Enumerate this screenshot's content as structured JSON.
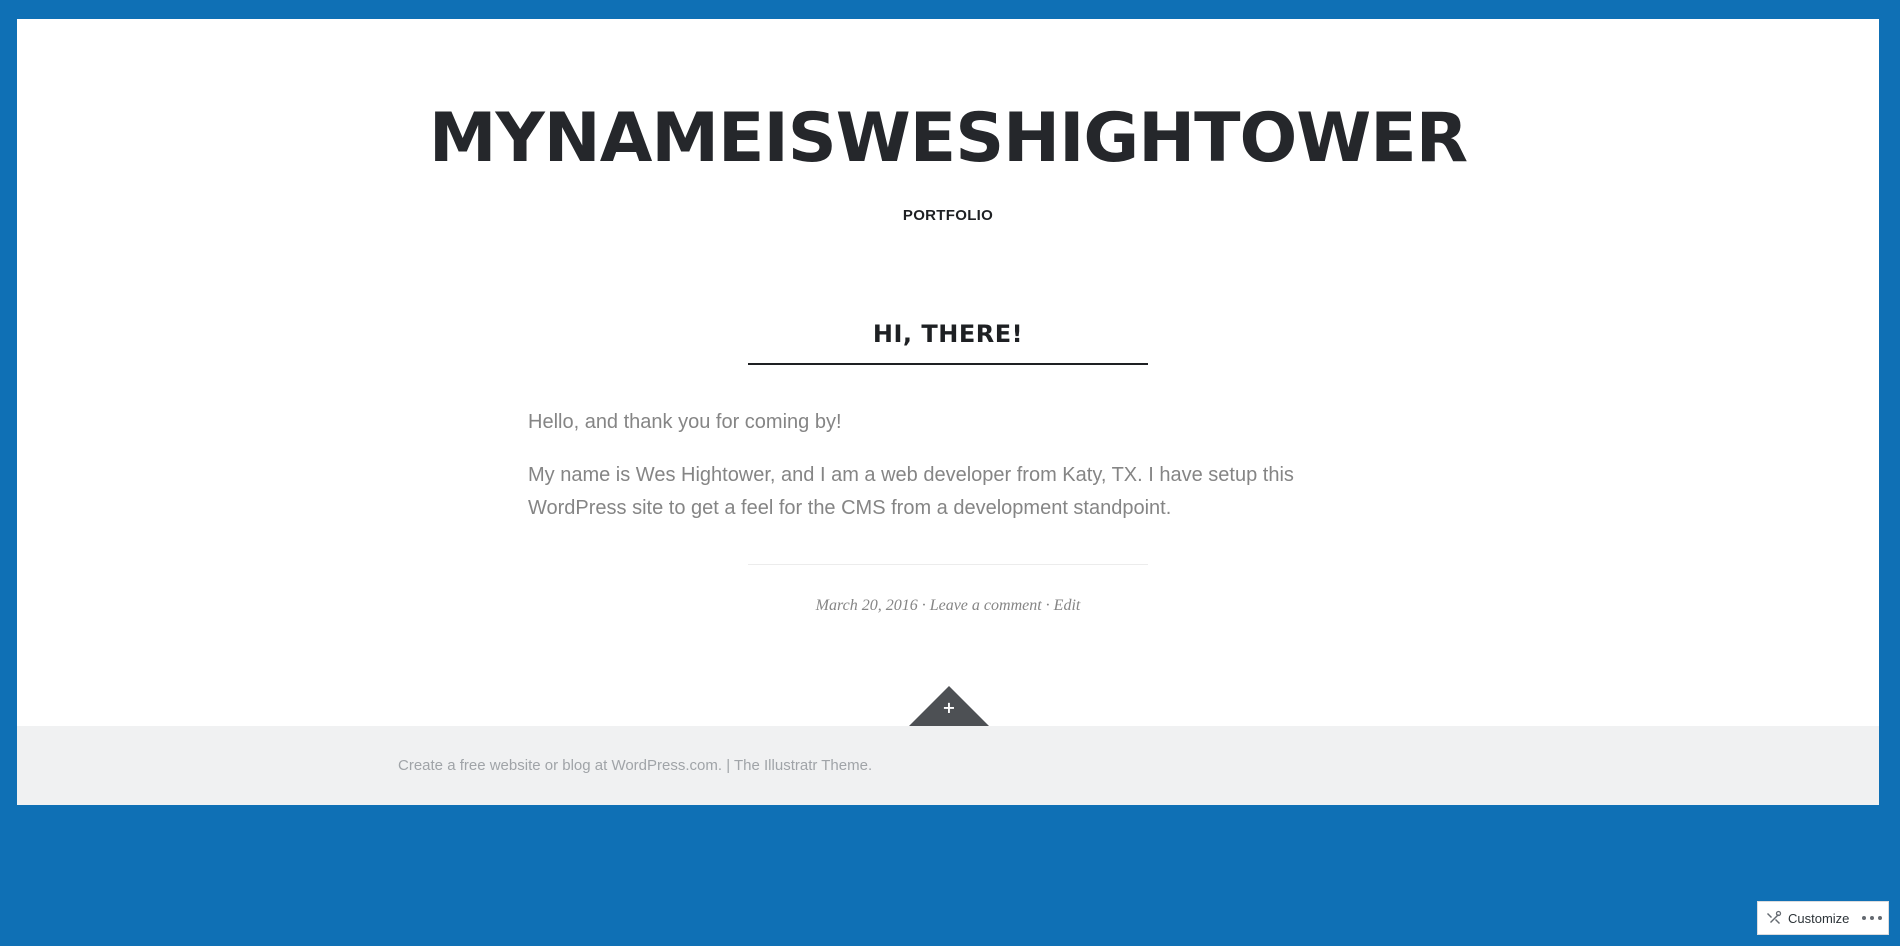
{
  "header": {
    "site_title": "MYNAMEISWESHIGHTOWER",
    "site_description": "PORTFOLIO"
  },
  "post": {
    "title": "HI, THERE!",
    "paragraphs": [
      "Hello, and thank you for coming by!",
      "My name is Wes Hightower, and I am a web developer from Katy, TX. I have setup this WordPress site to get a feel for the CMS from a development standpoint."
    ],
    "meta": {
      "date": "March 20, 2016",
      "separator": " · ",
      "comment_link": "Leave a comment",
      "edit_link": "Edit"
    }
  },
  "footer": {
    "wordpress_link": "Create a free website or blog at WordPress.com.",
    "separator": " | ",
    "theme_link": "The Illustratr Theme."
  },
  "widget_toggle": {
    "symbol": "+"
  },
  "customize_bar": {
    "label": "Customize",
    "icon": "customize-tools-icon",
    "more_icon": "more-dots-icon"
  },
  "colors": {
    "background": "#0f70b5",
    "page": "#ffffff",
    "title": "#25272b",
    "body_text": "#858585",
    "footer_bg": "#f0f1f2",
    "toggle": "#4d5054"
  }
}
